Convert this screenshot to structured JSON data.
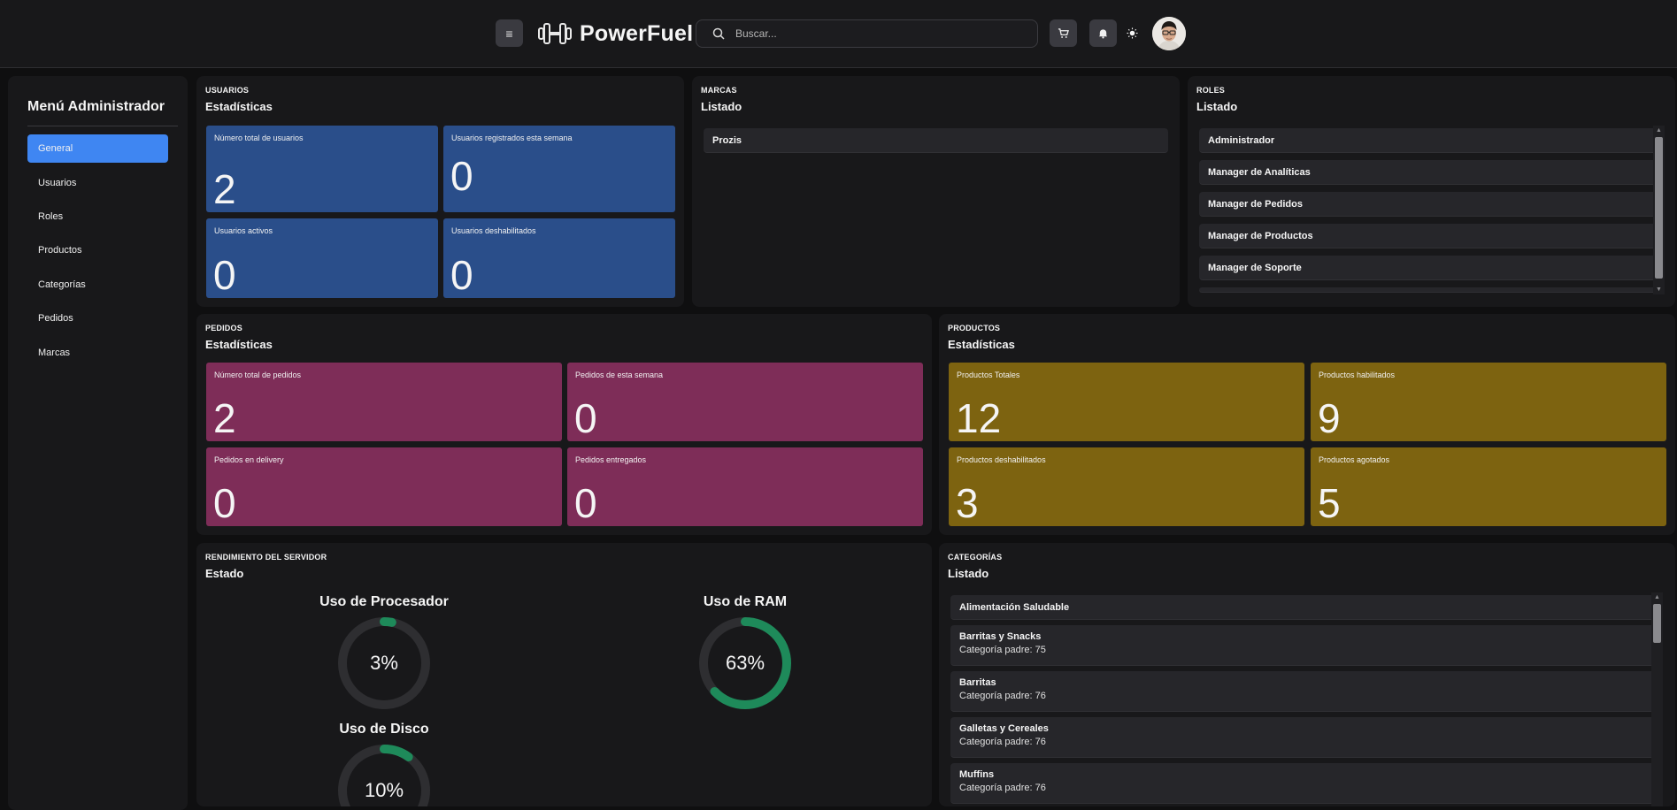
{
  "header": {
    "brand": "PowerFuel",
    "search_placeholder": "Buscar...",
    "menu_icon": "hamburger-icon",
    "cart_icon": "cart-icon",
    "bell_icon": "bell-icon",
    "theme_icon": "sun-icon"
  },
  "sidebar": {
    "title": "Menú Administrador",
    "items": [
      {
        "label": "General",
        "active": true
      },
      {
        "label": "Usuarios"
      },
      {
        "label": "Roles"
      },
      {
        "label": "Productos"
      },
      {
        "label": "Categorías"
      },
      {
        "label": "Pedidos"
      },
      {
        "label": "Marcas"
      }
    ]
  },
  "usuarios": {
    "category": "USUARIOS",
    "subtitle": "Estadísticas",
    "tiles": [
      {
        "label": "Número total de usuarios",
        "value": "2"
      },
      {
        "label": "Usuarios registrados esta semana",
        "value": "0"
      },
      {
        "label": "Usuarios activos",
        "value": "0"
      },
      {
        "label": "Usuarios deshabilitados",
        "value": "0"
      }
    ]
  },
  "marcas": {
    "category": "MARCAS",
    "subtitle": "Listado",
    "items": [
      "Prozis"
    ]
  },
  "roles": {
    "category": "ROLES",
    "subtitle": "Listado",
    "items": [
      "Administrador",
      "Manager de Analíticas",
      "Manager de Pedidos",
      "Manager de Productos",
      "Manager de Soporte"
    ]
  },
  "pedidos": {
    "category": "PEDIDOS",
    "subtitle": "Estadísticas",
    "tiles": [
      {
        "label": "Número total de pedidos",
        "value": "2"
      },
      {
        "label": "Pedidos de esta semana",
        "value": "0"
      },
      {
        "label": "Pedidos en delivery",
        "value": "0"
      },
      {
        "label": "Pedidos entregados",
        "value": "0"
      }
    ]
  },
  "productos": {
    "category": "PRODUCTOS",
    "subtitle": "Estadísticas",
    "tiles": [
      {
        "label": "Productos Totales",
        "value": "12"
      },
      {
        "label": "Productos habilitados",
        "value": "9"
      },
      {
        "label": "Productos deshabilitados",
        "value": "3"
      },
      {
        "label": "Productos agotados",
        "value": "5"
      }
    ]
  },
  "servidor": {
    "category": "RENDIMIENTO DEL SERVIDOR",
    "subtitle": "Estado",
    "gauges": [
      {
        "title": "Uso de Procesador",
        "label": "3%",
        "value": 3
      },
      {
        "title": "Uso de RAM",
        "label": "63%",
        "value": 63
      },
      {
        "title": "Uso de Disco",
        "label": "10%",
        "value": 10
      }
    ],
    "gauge_color": "#1e8a5a",
    "track_color": "#2e2e31"
  },
  "categorias": {
    "category": "CATEGORÍAS",
    "subtitle": "Listado",
    "items": [
      {
        "name": "Alimentación Saludable",
        "parent": ""
      },
      {
        "name": "Barritas y Snacks",
        "parent": "Categoría padre: 75"
      },
      {
        "name": "Barritas",
        "parent": "Categoría padre: 76"
      },
      {
        "name": "Galletas y Cereales",
        "parent": "Categoría padre: 76"
      },
      {
        "name": "Muffins",
        "parent": "Categoría padre: 76"
      }
    ]
  }
}
